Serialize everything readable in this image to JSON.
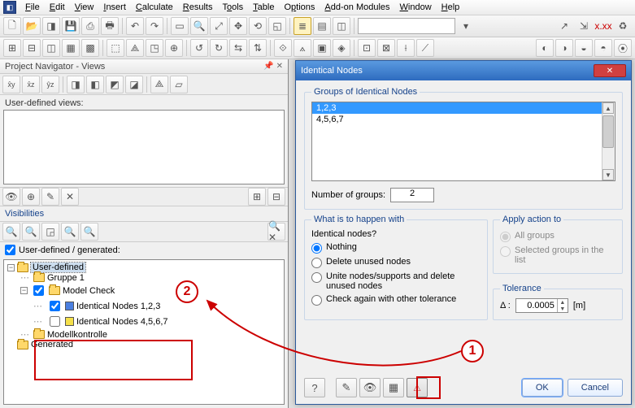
{
  "menu": [
    "File",
    "Edit",
    "View",
    "Insert",
    "Calculate",
    "Results",
    "Tools",
    "Table",
    "Options",
    "Add-on Modules",
    "Window",
    "Help"
  ],
  "navigator": {
    "title": "Project Navigator - Views",
    "user_views_label": "User-defined views:",
    "visibilities_label": "Visibilities",
    "usergen_label": "User-defined / generated:",
    "tree": {
      "root": "User-defined",
      "gruppe": "Gruppe 1",
      "modelcheck": "Model Check",
      "id123": "Identical Nodes 1,2,3",
      "id4567": "Identical Nodes 4,5,6,7",
      "modellkontrolle": "Modellkontrolle",
      "generated": "Generated"
    }
  },
  "dialog": {
    "title": "Identical Nodes",
    "groups_label": "Groups of Identical Nodes",
    "list": [
      "1,2,3",
      "4,5,6,7"
    ],
    "num_groups_label": "Number of groups:",
    "num_groups": "2",
    "whathappen_label": "What is to happen with",
    "identical_q": "Identical nodes?",
    "opt_nothing": "Nothing",
    "opt_delete": "Delete unused nodes",
    "opt_unite": "Unite nodes/supports and delete unused nodes",
    "opt_checkagain": "Check again with other tolerance",
    "apply_label": "Apply action to",
    "apply_all": "All groups",
    "apply_sel": "Selected groups in the list",
    "tol_label": "Tolerance",
    "tol_delta": "Δ :",
    "tol_val": "0.0005",
    "tol_unit": "[m]",
    "ok": "OK",
    "cancel": "Cancel"
  },
  "anno": {
    "one": "1",
    "two": "2"
  }
}
